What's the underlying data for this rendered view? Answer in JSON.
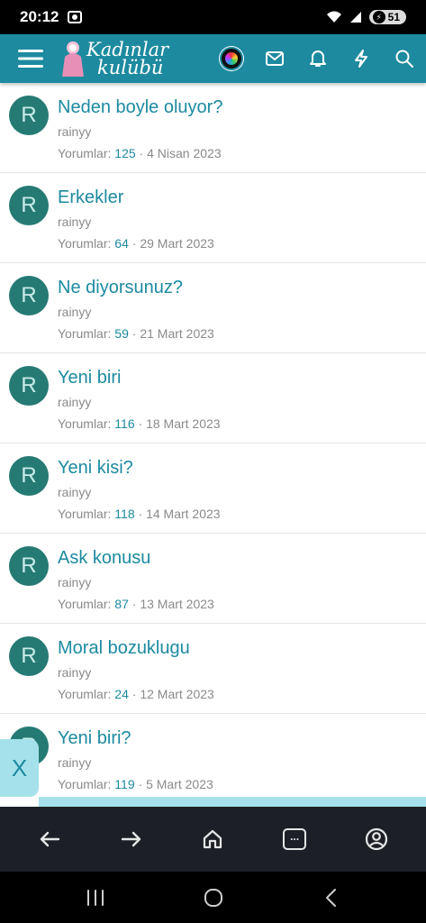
{
  "status": {
    "time": "20:12",
    "battery": "51"
  },
  "header": {
    "logo_line1": "Kadınlar",
    "logo_line2": "kulübü",
    "icons": [
      "menu-icon",
      "user-avatar",
      "mail-icon",
      "bell-icon",
      "lightning-icon",
      "search-icon"
    ]
  },
  "threads": [
    {
      "initial": "R",
      "title": "Neden boyle oluyor?",
      "author": "rainyy",
      "replies_label": "Yorumlar:",
      "replies": "125",
      "sep": "·",
      "date": "4 Nisan 2023"
    },
    {
      "initial": "R",
      "title": "Erkekler",
      "author": "rainyy",
      "replies_label": "Yorumlar:",
      "replies": "64",
      "sep": "·",
      "date": "29 Mart 2023"
    },
    {
      "initial": "R",
      "title": "Ne diyorsunuz?",
      "author": "rainyy",
      "replies_label": "Yorumlar:",
      "replies": "59",
      "sep": "·",
      "date": "21 Mart 2023"
    },
    {
      "initial": "R",
      "title": "Yeni biri",
      "author": "rainyy",
      "replies_label": "Yorumlar:",
      "replies": "116",
      "sep": "·",
      "date": "18 Mart 2023"
    },
    {
      "initial": "R",
      "title": "Yeni kisi?",
      "author": "rainyy",
      "replies_label": "Yorumlar:",
      "replies": "118",
      "sep": "·",
      "date": "14 Mart 2023"
    },
    {
      "initial": "R",
      "title": "Ask konusu",
      "author": "rainyy",
      "replies_label": "Yorumlar:",
      "replies": "87",
      "sep": "·",
      "date": "13 Mart 2023"
    },
    {
      "initial": "R",
      "title": "Moral bozuklugu",
      "author": "rainyy",
      "replies_label": "Yorumlar:",
      "replies": "24",
      "sep": "·",
      "date": "12 Mart 2023"
    },
    {
      "initial": "R",
      "title": "Yeni biri?",
      "author": "rainyy",
      "replies_label": "Yorumlar:",
      "replies": "119",
      "sep": "·",
      "date": "5 Mart 2023"
    }
  ],
  "overlay": {
    "close_label": "X"
  },
  "browser_nav": {
    "tabs_label": "..."
  },
  "colors": {
    "accent": "#1d8aa0",
    "avatar": "#267a74",
    "overlay": "#a5e1ea",
    "browser_bar": "#1c2026"
  }
}
